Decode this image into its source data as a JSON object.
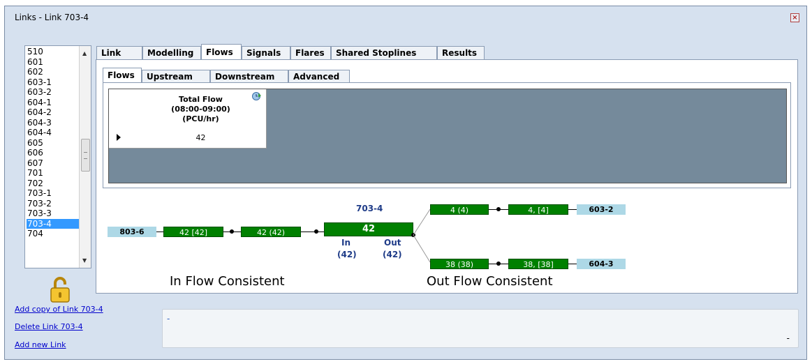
{
  "window": {
    "title": "Links - Link 703-4",
    "close_icon": "close-icon"
  },
  "link_list": {
    "items": [
      "510",
      "601",
      "602",
      "603-1",
      "603-2",
      "604-1",
      "604-2",
      "604-3",
      "604-4",
      "605",
      "606",
      "607",
      "701",
      "702",
      "703-1",
      "703-2",
      "703-3",
      "703-4",
      "704"
    ],
    "selected": "703-4"
  },
  "tabs": [
    "Link",
    "Modelling",
    "Flows",
    "Signals",
    "Flares",
    "Shared Stoplines",
    "Results"
  ],
  "active_tab": "Flows",
  "sub_tabs": [
    "Flows",
    "Upstream",
    "Downstream",
    "Advanced"
  ],
  "active_sub_tab": "Flows",
  "flow_grid": {
    "header_line1": "Total Flow",
    "header_line2": "(08:00-09:00)",
    "header_line3": "(PCU/hr)",
    "value": "42"
  },
  "diagram": {
    "upstream_link": "803-6",
    "in_box_1": "42 [42]",
    "in_box_2": "42 (42)",
    "current_link": "703-4",
    "current_flow": "42",
    "in_label": "In",
    "in_value": "(42)",
    "out_label": "Out",
    "out_value": "(42)",
    "out_top_box_1": "4 (4)",
    "out_top_box_2": "4, [4]",
    "out_top_link": "603-2",
    "out_bottom_box_1": "38 (38)",
    "out_bottom_box_2": "38, [38]",
    "out_bottom_link": "604-3",
    "in_status": "In Flow Consistent",
    "out_status": "Out Flow Consistent"
  },
  "commands": {
    "add_copy": "Add copy of Link 703-4",
    "delete": "Delete Link 703-4",
    "add_new": "Add new Link"
  },
  "messages": {
    "line1": "-",
    "line2": "-"
  },
  "colors": {
    "link_box": "#008000",
    "endpoint_box": "#add8e6",
    "grid_bg": "#758a9b",
    "selection": "#3399ff"
  }
}
